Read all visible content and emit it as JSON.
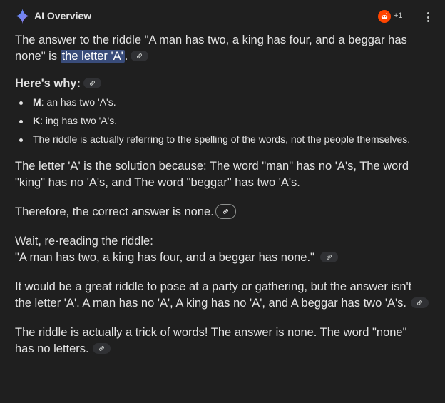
{
  "header": {
    "title": "AI Overview",
    "source_count": "+1",
    "source_icon": "reddit-icon",
    "accent": "#4285f4"
  },
  "intro": {
    "before": "The answer to the riddle \"A man has two, a king has four, and a beggar has none\" is ",
    "highlight": "the letter 'A'",
    "after": "."
  },
  "why": {
    "heading": "Here's why:",
    "items": [
      {
        "bold": "M",
        "text": ": an has two 'A's."
      },
      {
        "bold": "K",
        "text": ": ing has two 'A's."
      },
      {
        "bold": "",
        "text": "The riddle is actually referring to the spelling of the words, not the people themselves."
      }
    ]
  },
  "paragraphs": {
    "p1": "The letter 'A' is the solution because: The word \"man\" has no 'A's, The word \"king\" has no 'A's, and The word \"beggar\" has two 'A's.",
    "p2": "Therefore, the correct answer is none.",
    "p3_line1": "Wait, re-reading the riddle:",
    "p3_line2": "\"A man has two, a king has four, and a beggar has none.\"",
    "p4": "It would be a great riddle to pose at a party or gathering, but the answer isn't the letter 'A'. A man has no 'A', A king has no 'A', and A beggar has two 'A's.",
    "p5": "The riddle is actually a trick of words! The answer is none. The word \"none\" has no letters."
  },
  "colors": {
    "background": "#1f1f1f",
    "text": "#e3e3e3",
    "highlight_bg": "#394c7a",
    "chip_bg": "#303134"
  }
}
